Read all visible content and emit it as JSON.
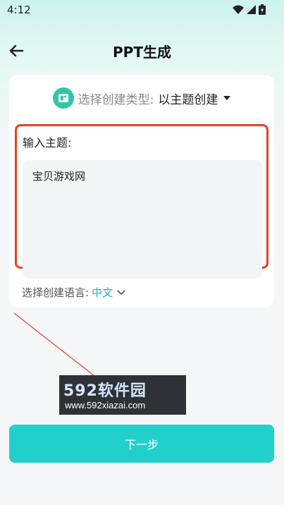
{
  "status_bar": {
    "time": "4:12"
  },
  "header": {
    "title": "PPT生成"
  },
  "type_select": {
    "label": "选择创建类型:",
    "value": "以主题创建"
  },
  "topic": {
    "label": "输入主题:",
    "value": "宝贝游戏网"
  },
  "language": {
    "label": "选择创建语言:",
    "value": "中文"
  },
  "watermark": {
    "brand": "592软件园",
    "url": "www.592xiazai.com"
  },
  "footer": {
    "next_label": "下一步"
  },
  "colors": {
    "accent": "#21d0cb",
    "highlight_border": "#e2432b",
    "language_value": "#1fb5c4"
  }
}
